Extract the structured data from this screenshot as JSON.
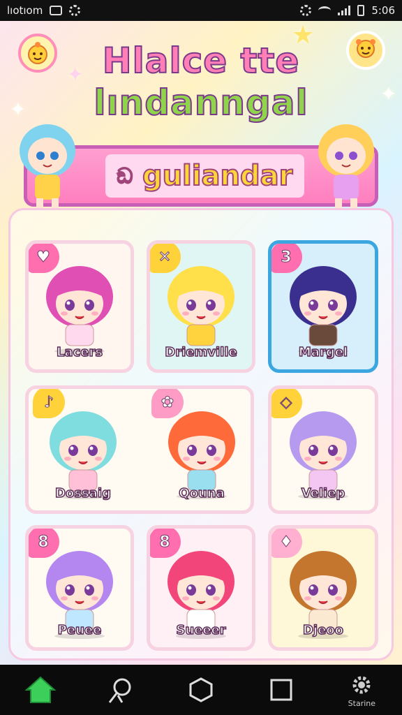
{
  "status_bar": {
    "left_text": "lıotıom",
    "time": "5:06"
  },
  "title": {
    "line1": "Hlalce tte",
    "line2": "lındanngal"
  },
  "banner": {
    "icon": "rabbit-icon",
    "text": "guliandar"
  },
  "characters": [
    {
      "name": "Lacers",
      "tag": "♥",
      "tag_color": "#ff6fb0",
      "hair": "#e04fb3",
      "outfit": "#ffd9ee",
      "card_bg": "#fff6f0",
      "selected": false
    },
    {
      "name": "Driemville",
      "tag": "✕",
      "tag_color": "#ffd23a",
      "hair": "#ffe04a",
      "outfit": "#ffd33d",
      "card_bg": "#dff6f4",
      "selected": false
    },
    {
      "name": "Margel",
      "tag": "3",
      "tag_color": "#ff6fb0",
      "hair": "#3a2f8f",
      "outfit": "#6a4a3a",
      "card_bg": "#d7eefb",
      "selected": true
    },
    {
      "name": "Dossaig",
      "tag": "♪",
      "tag_color": "#ffd23a",
      "hair": "#7fdde0",
      "outfit": "#ffc0d8",
      "card_bg": "#fffaf2",
      "selected": false
    },
    {
      "name": "Qouna",
      "tag": "✿",
      "tag_color": "#ff9cc6",
      "hair": "#ff6a3a",
      "outfit": "#9adff0",
      "card_bg": "#fffaf2",
      "selected": false
    },
    {
      "name": "Veliep",
      "tag": "◇",
      "tag_color": "#ffd23a",
      "hair": "#b59af0",
      "outfit": "#f3c7f2",
      "card_bg": "#fffaf2",
      "selected": false
    },
    {
      "name": "Peuee",
      "tag": "8",
      "tag_color": "#ff6fb0",
      "hair": "#b486ef",
      "outfit": "#bfe7ff",
      "card_bg": "#fffaf2",
      "selected": false
    },
    {
      "name": "Sueeer",
      "tag": "8",
      "tag_color": "#ff6fb0",
      "hair": "#f2457a",
      "outfit": "#ffffff",
      "card_bg": "#fff0f6",
      "selected": false
    },
    {
      "name": "Djeoo",
      "tag": "♦",
      "tag_color": "#ffb0d0",
      "hair": "#c4762e",
      "outfit": "#fce9d1",
      "card_bg": "#fff8d8",
      "selected": false
    }
  ],
  "nav": [
    {
      "icon": "home-icon",
      "label": ""
    },
    {
      "icon": "search-icon",
      "label": ""
    },
    {
      "icon": "hexagon-icon",
      "label": ""
    },
    {
      "icon": "square-icon",
      "label": ""
    },
    {
      "icon": "gear-icon",
      "label": "Starine"
    }
  ]
}
